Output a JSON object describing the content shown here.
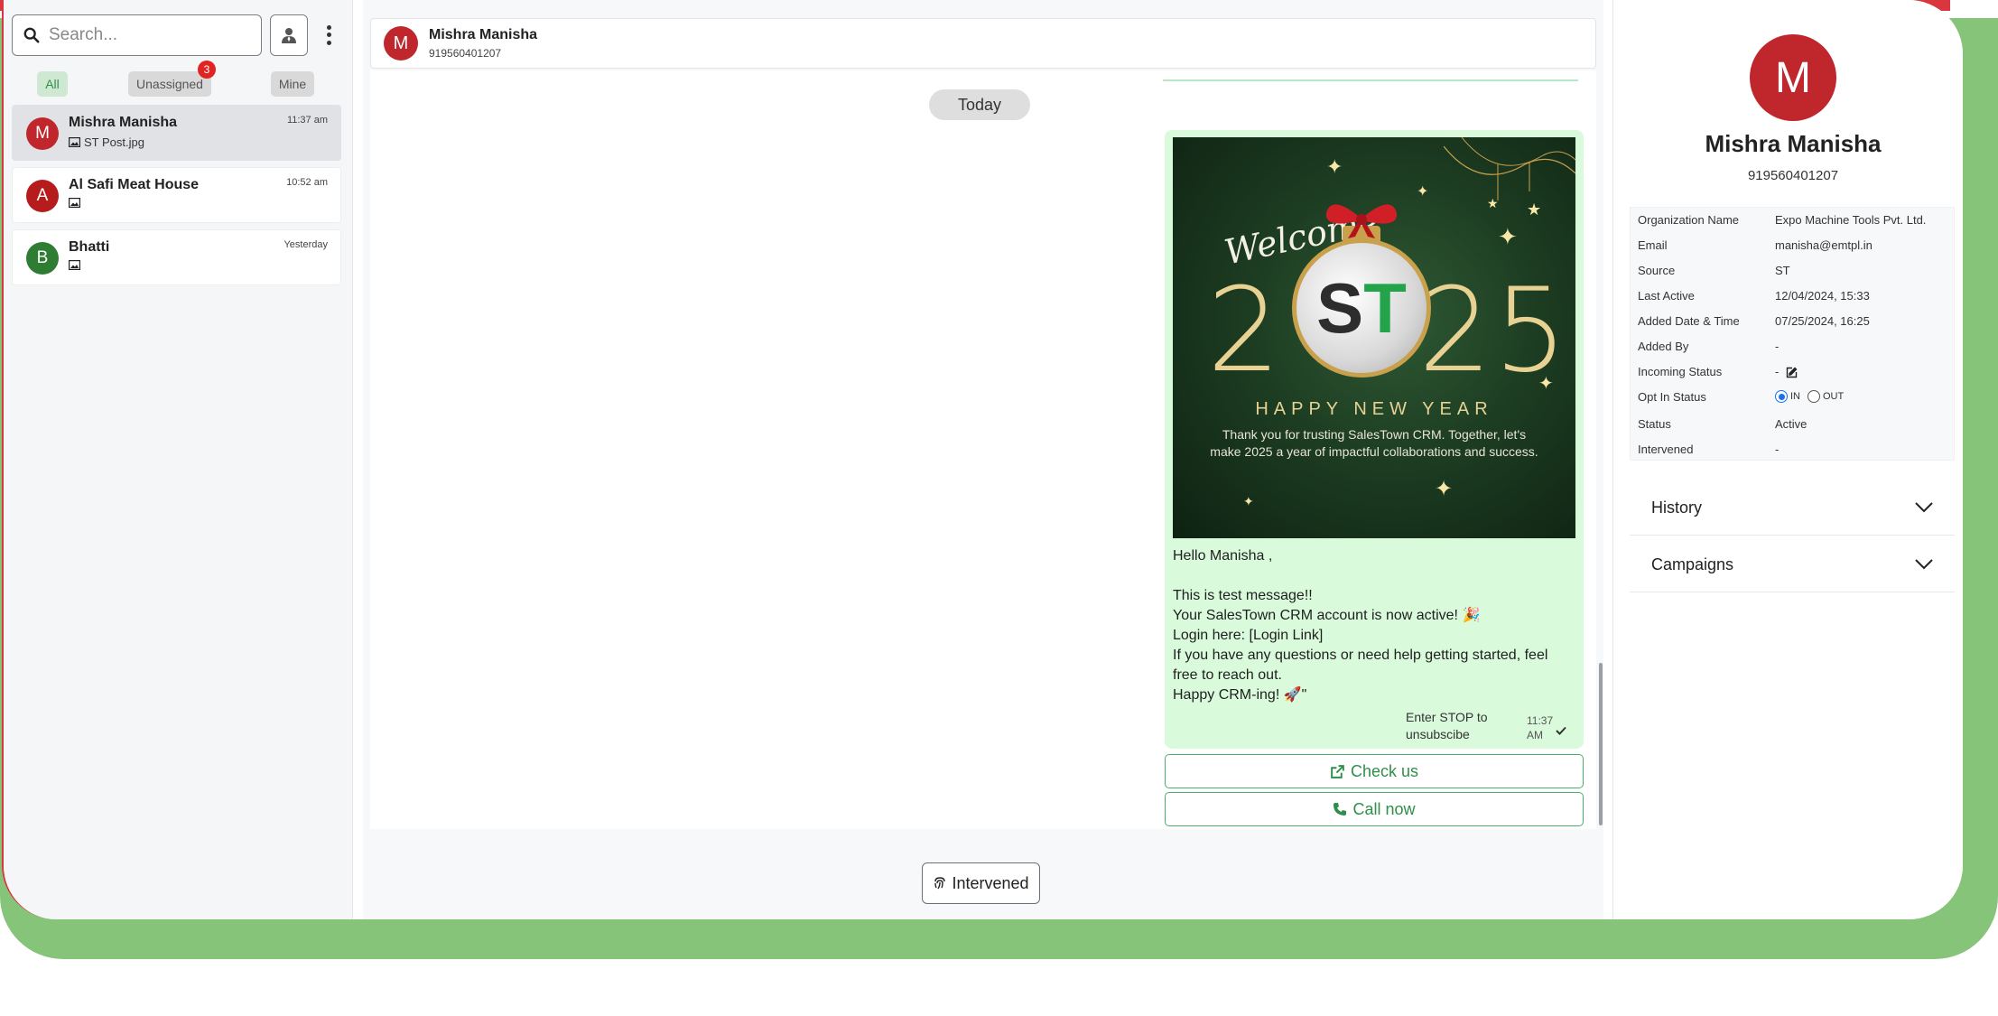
{
  "search": {
    "placeholder": "Search..."
  },
  "filters": {
    "all": "All",
    "unassigned": "Unassigned",
    "unassigned_count": "3",
    "mine": "Mine"
  },
  "conversations": [
    {
      "initial": "M",
      "name": "Mishra Manisha",
      "preview": "ST Post.jpg",
      "time": "11:37 am",
      "color": "#c0272d"
    },
    {
      "initial": "A",
      "name": "Al Safi Meat House",
      "preview": "",
      "time": "10:52 am",
      "color": "#b71c1c"
    },
    {
      "initial": "B",
      "name": "Bhatti",
      "preview": "",
      "time": "Yesterday",
      "color": "#2e7d32"
    }
  ],
  "chat_header": {
    "initial": "M",
    "name": "Mishra Manisha",
    "phone": "919560401207"
  },
  "chat": {
    "date_divider": "Today",
    "poster": {
      "welcome": "Welcome",
      "year_left": "2",
      "logo_s": "S",
      "logo_t": "T",
      "year_right": "25",
      "headline": "HAPPY NEW YEAR",
      "thanks": "Thank you for trusting SalesTown CRM. Together, let's make 2025 a year of impactful collaborations and success."
    },
    "message": "Hello Manisha ,\n\nThis is test message!!\nYour SalesTown CRM account is now active! 🎉\nLogin here: [Login Link]\nIf you have any questions or need help getting started, feel free to reach out.\nHappy CRM-ing! 🚀\"",
    "footer": "Enter STOP to unsubscibe",
    "time": "11:37 AM",
    "cta_check": "Check us",
    "cta_call": "Call now",
    "intervened_button": "Intervened"
  },
  "contact": {
    "initial": "M",
    "name": "Mishra Manisha",
    "phone": "919560401207",
    "fields": [
      {
        "label": "Organization Name",
        "value": "Expo Machine Tools Pvt. Ltd."
      },
      {
        "label": "Email",
        "value": "manisha@emtpl.in"
      },
      {
        "label": "Source",
        "value": "ST"
      },
      {
        "label": "Last Active",
        "value": "12/04/2024, 15:33"
      },
      {
        "label": "Added Date & Time",
        "value": "07/25/2024, 16:25"
      },
      {
        "label": "Added By",
        "value": "-"
      },
      {
        "label": "Incoming Status",
        "value": "-"
      },
      {
        "label": "Opt In Status",
        "value": ""
      },
      {
        "label": "Status",
        "value": "Active"
      },
      {
        "label": "Intervened",
        "value": "-"
      }
    ],
    "opt_in": {
      "in_label": "IN",
      "out_label": "OUT",
      "selected": "IN"
    },
    "sections": [
      {
        "label": "History"
      },
      {
        "label": "Campaigns"
      }
    ]
  },
  "colors": {
    "accent_green": "#2f8f4a",
    "bubble_green": "#d9fbdc",
    "avatar_red": "#c0272d",
    "frame_green": "#86c47a"
  }
}
